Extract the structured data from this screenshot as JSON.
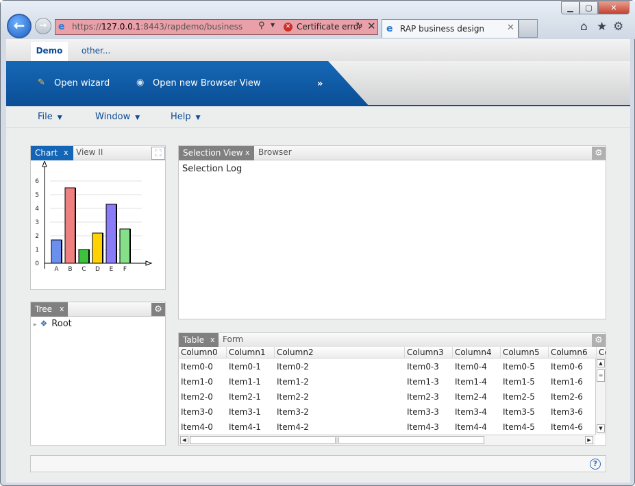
{
  "browser": {
    "address_url_prefix": "https://",
    "address_host": "127.0.0.1",
    "address_url_rest": ":8443/rapdemo/business",
    "cert_error": "Certificate error",
    "tab_title": "RAP business design",
    "icons": {
      "back": "arrow-left-icon",
      "forward": "arrow-right-icon",
      "home": "home-icon",
      "favorites": "star-icon",
      "tools": "gear-icon"
    }
  },
  "app": {
    "top_tabs": [
      {
        "label": "Demo"
      },
      {
        "label": "other..."
      }
    ],
    "banner": {
      "wizard": "Open wizard",
      "browser_view": "Open new Browser View",
      "more": "»"
    },
    "menus": [
      {
        "label": "File"
      },
      {
        "label": "Window"
      },
      {
        "label": "Help"
      }
    ]
  },
  "views": {
    "chart": {
      "tab": "Chart",
      "tab_inactive": "View II"
    },
    "selection": {
      "tab": "Selection View",
      "tab_inactive": "Browser",
      "content": "Selection Log"
    },
    "tree": {
      "tab": "Tree",
      "root": "Root"
    },
    "table": {
      "tab": "Table",
      "tab_inactive": "Form"
    }
  },
  "chart_data": {
    "type": "bar",
    "categories": [
      "A",
      "B",
      "C",
      "D",
      "E",
      "F"
    ],
    "values": [
      1.7,
      5.5,
      1.0,
      2.2,
      4.3,
      2.5
    ],
    "colors": [
      "#6b8fef",
      "#f07f7f",
      "#3cc23c",
      "#ffd200",
      "#8a7cf6",
      "#86e08a"
    ],
    "ylim": [
      0,
      6
    ],
    "yticks": [
      "0",
      "1",
      "2",
      "3",
      "4",
      "5",
      "6"
    ],
    "grid": true
  },
  "table": {
    "columns": [
      "Column0",
      "Column1",
      "Column2",
      "Column3",
      "Column4",
      "Column5",
      "Column6",
      "Co"
    ],
    "rows": [
      [
        "Item0-0",
        "Item0-1",
        "Item0-2",
        "Item0-3",
        "Item0-4",
        "Item0-5",
        "Item0-6"
      ],
      [
        "Item1-0",
        "Item1-1",
        "Item1-2",
        "Item1-3",
        "Item1-4",
        "Item1-5",
        "Item1-6"
      ],
      [
        "Item2-0",
        "Item2-1",
        "Item2-2",
        "Item2-3",
        "Item2-4",
        "Item2-5",
        "Item2-6"
      ],
      [
        "Item3-0",
        "Item3-1",
        "Item3-2",
        "Item3-3",
        "Item3-4",
        "Item3-5",
        "Item3-6"
      ],
      [
        "Item4-0",
        "Item4-1",
        "Item4-2",
        "Item4-3",
        "Item4-4",
        "Item4-5",
        "Item4-6"
      ]
    ]
  },
  "status": {
    "help_icon": "help-icon"
  }
}
